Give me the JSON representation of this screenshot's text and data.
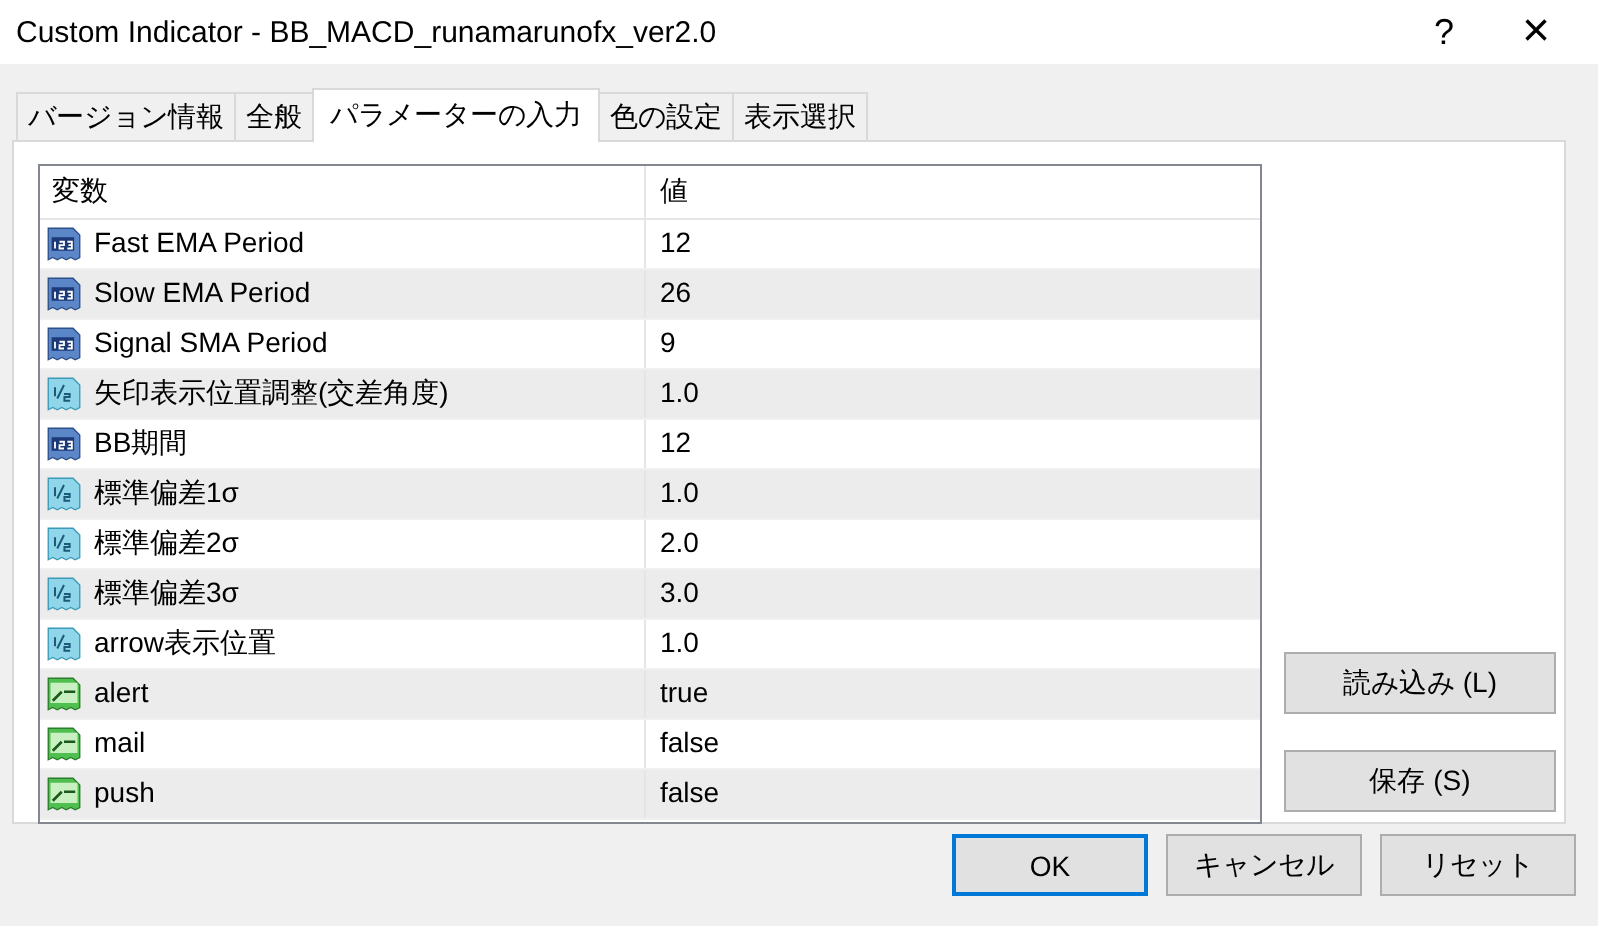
{
  "window": {
    "title": "Custom Indicator - BB_MACD_runamarunofx_ver2.0",
    "help": "?",
    "close": "×"
  },
  "tabs": [
    {
      "label": "バージョン情報",
      "selected": false
    },
    {
      "label": "全般",
      "selected": false
    },
    {
      "label": "パラメーターの入力",
      "selected": true
    },
    {
      "label": "色の設定",
      "selected": false
    },
    {
      "label": "表示選択",
      "selected": false
    }
  ],
  "table": {
    "columns": [
      "変数",
      "値"
    ],
    "rows": [
      {
        "kind": "int",
        "name": "Fast EMA Period",
        "value": "12"
      },
      {
        "kind": "int",
        "name": "Slow EMA Period",
        "value": "26"
      },
      {
        "kind": "int",
        "name": "Signal SMA Period",
        "value": "9"
      },
      {
        "kind": "double",
        "name": "矢印表示位置調整(交差角度)",
        "value": "1.0"
      },
      {
        "kind": "int",
        "name": "BB期間",
        "value": "12"
      },
      {
        "kind": "double",
        "name": "標準偏差1σ",
        "value": "1.0"
      },
      {
        "kind": "double",
        "name": "標準偏差2σ",
        "value": "2.0"
      },
      {
        "kind": "double",
        "name": "標準偏差3σ",
        "value": "3.0"
      },
      {
        "kind": "double",
        "name": "arrow表示位置",
        "value": "1.0"
      },
      {
        "kind": "bool",
        "name": "alert",
        "value": "true"
      },
      {
        "kind": "bool",
        "name": "mail",
        "value": "false"
      },
      {
        "kind": "bool",
        "name": "push",
        "value": "false"
      }
    ]
  },
  "side_buttons": [
    "読み込み (L)",
    "保存 (S)"
  ],
  "buttons": [
    {
      "label": "OK",
      "default": true
    },
    {
      "label": "キャンセル",
      "default": false
    },
    {
      "label": "リセット",
      "default": false
    }
  ]
}
